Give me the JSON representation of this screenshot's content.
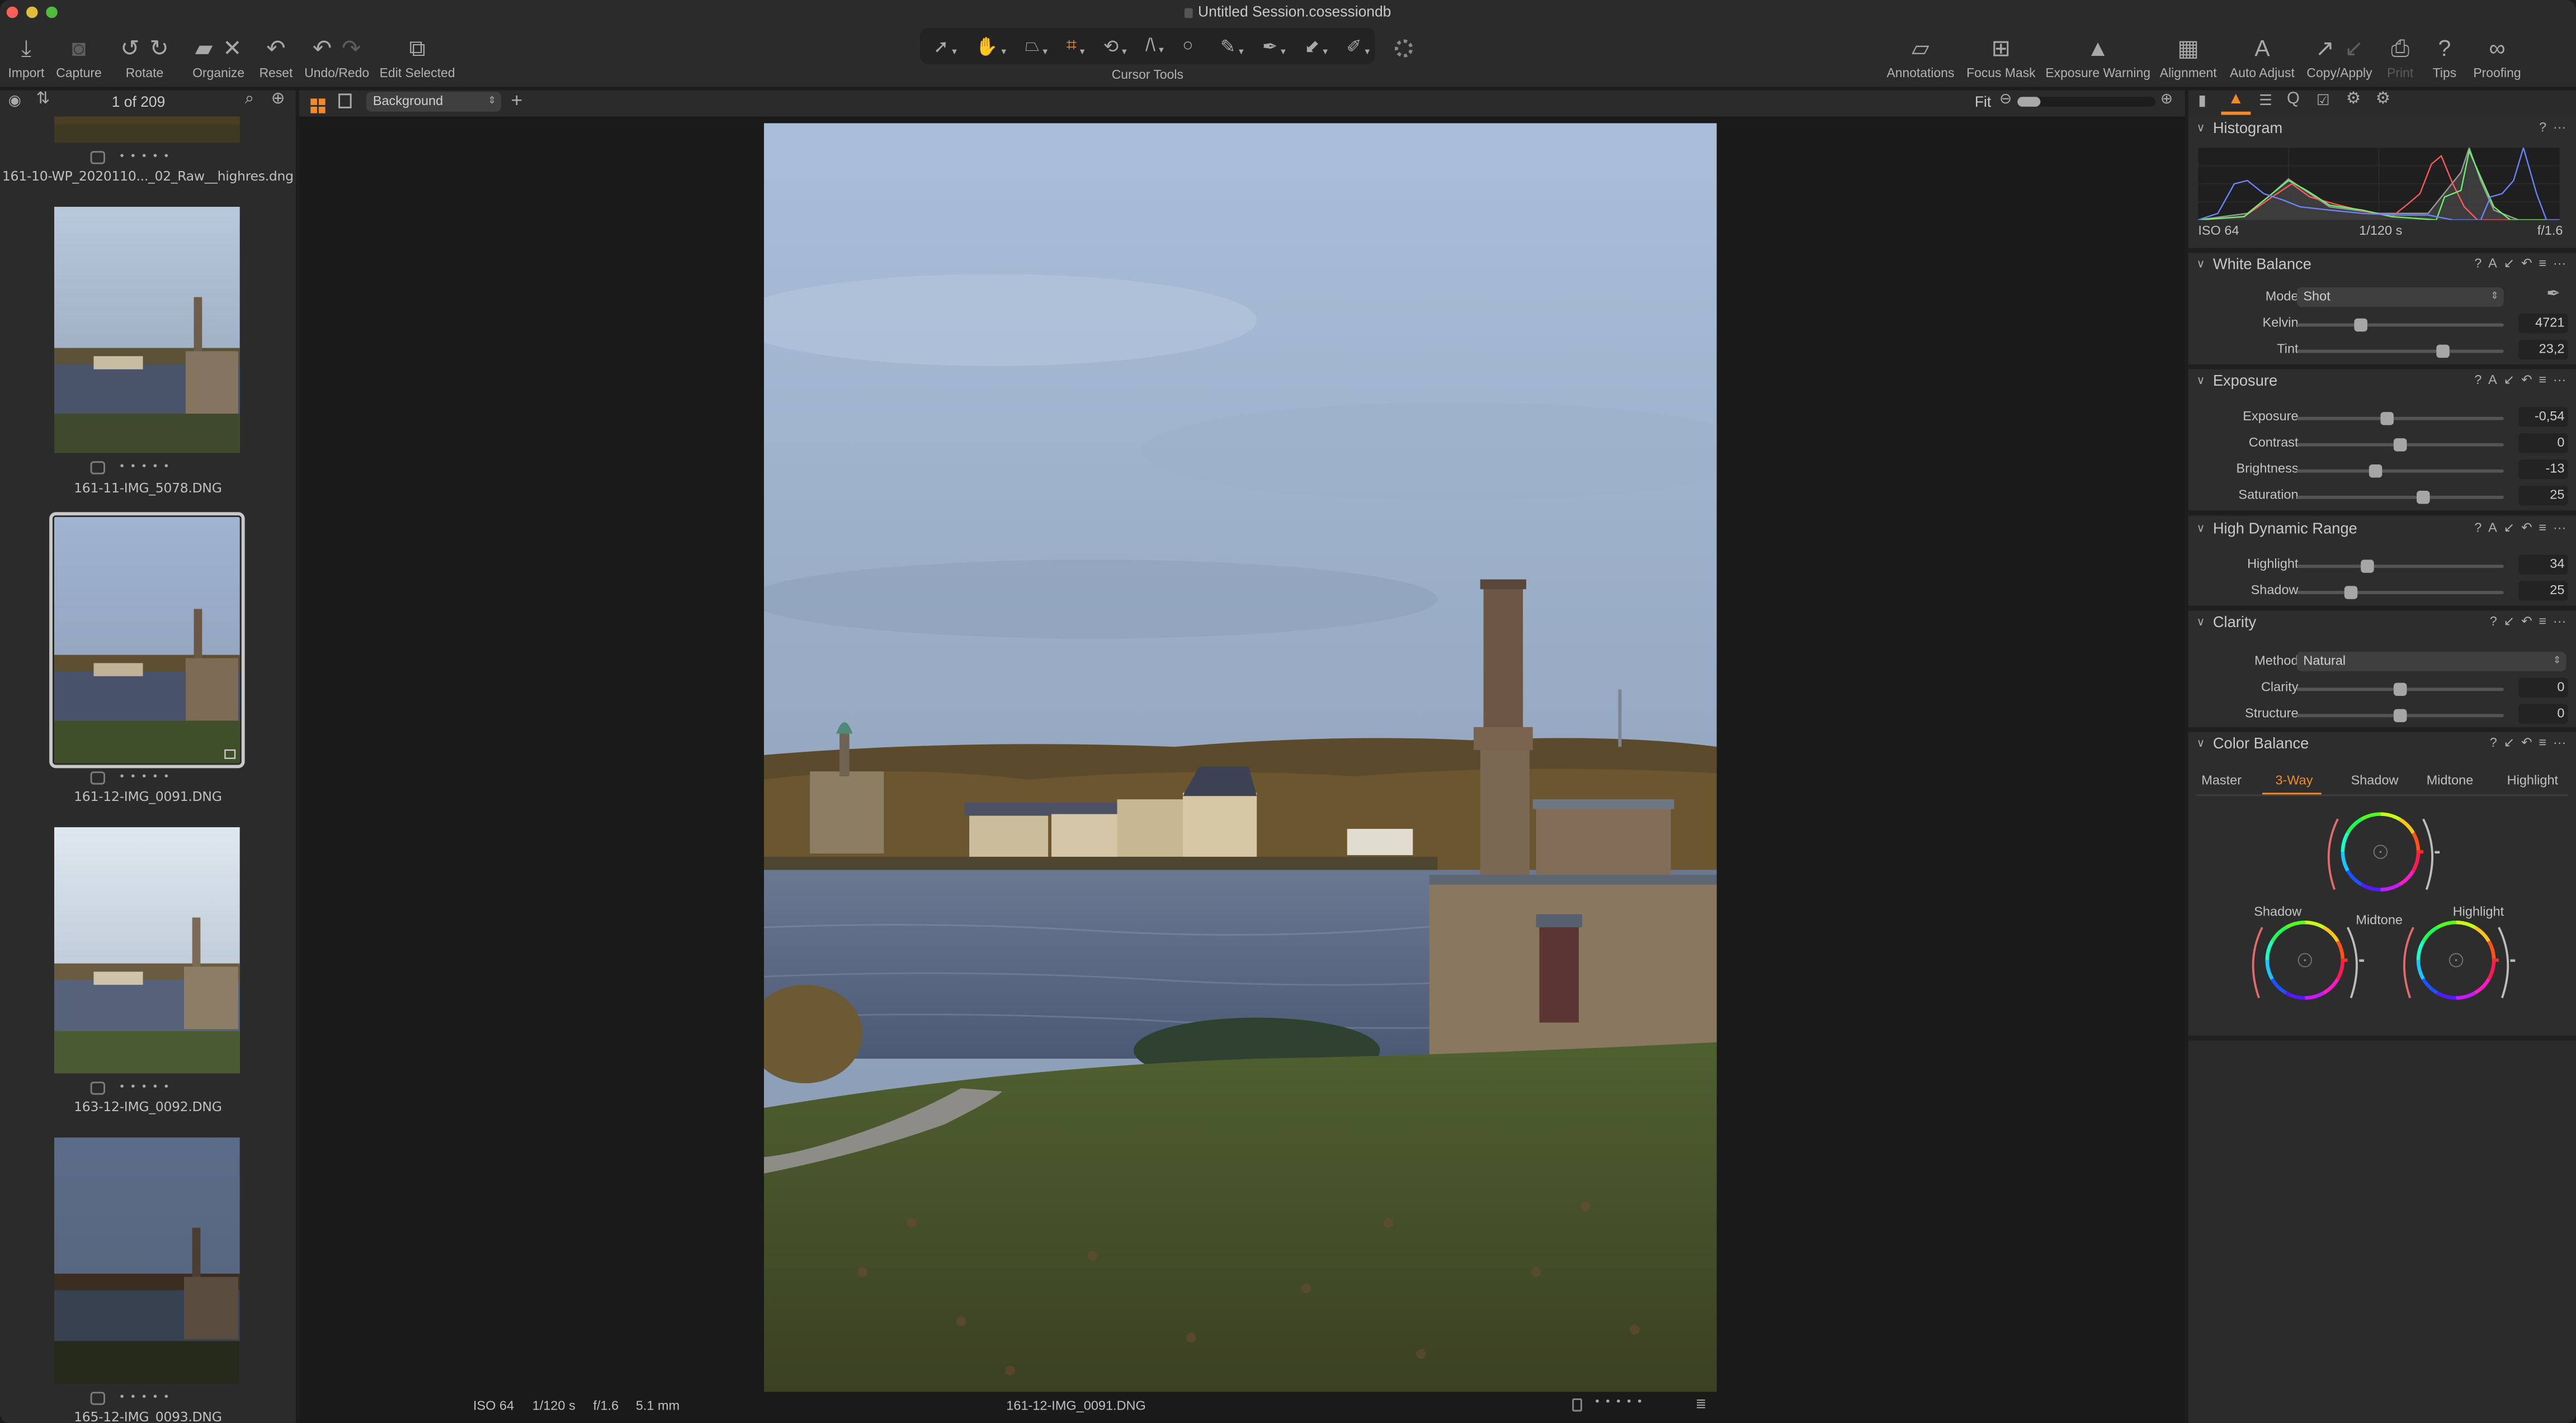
{
  "window": {
    "title": "Untitled Session.cosessiondb",
    "traffic_lights": [
      {
        "name": "close",
        "color": "#fe5f57"
      },
      {
        "name": "minimize",
        "color": "#e2bd39"
      },
      {
        "name": "zoom",
        "color": "#4fbd3b"
      }
    ]
  },
  "toolbar": {
    "left_groups": [
      {
        "label": "Import",
        "icons": [
          "import-icon"
        ]
      },
      {
        "label": "Capture",
        "icons": [
          "camera-icon"
        ]
      },
      {
        "label": "Rotate",
        "icons": [
          "rotate-left-icon",
          "rotate-right-icon"
        ]
      },
      {
        "label": "Organize",
        "icons": [
          "move-to-folder-icon",
          "delete-icon"
        ]
      },
      {
        "label": "Reset",
        "icons": [
          "reset-icon"
        ]
      },
      {
        "label": "Undo/Redo",
        "icons": [
          "undo-icon",
          "redo-icon"
        ]
      },
      {
        "label": "Edit Selected",
        "icons": [
          "edit-selected-icon"
        ]
      }
    ],
    "cursor_tools": {
      "label": "Cursor Tools",
      "tools": [
        "select-icon",
        "pan-icon",
        "keystone-icon",
        "crop-icon",
        "rotate-tool-icon",
        "straighten-icon",
        "spot-removal-icon",
        "brush-icon",
        "color-picker-icon",
        "eraser-icon",
        "annotate-pen-icon"
      ],
      "active": "crop-icon"
    },
    "right_groups": [
      {
        "label": "Annotations",
        "icons": [
          "annotations-icon"
        ],
        "disabled": false
      },
      {
        "label": "Focus Mask",
        "icons": [
          "focus-mask-icon"
        ],
        "disabled": false
      },
      {
        "label": "Exposure Warning",
        "icons": [
          "exposure-warning-icon"
        ],
        "disabled": false
      },
      {
        "label": "Alignment",
        "icons": [
          "grid-icon"
        ],
        "disabled": false
      },
      {
        "label": "Auto Adjust",
        "icons": [
          "auto-adjust-icon"
        ],
        "disabled": false
      },
      {
        "label": "Copy/Apply",
        "icons": [
          "copy-icon",
          "apply-icon"
        ],
        "disabled": false
      },
      {
        "label": "Print",
        "icons": [
          "printer-icon"
        ],
        "disabled": true
      },
      {
        "label": "Tips",
        "icons": [
          "help-icon"
        ],
        "disabled": false
      },
      {
        "label": "Proofing",
        "icons": [
          "proofing-glasses-icon"
        ],
        "disabled": false
      }
    ]
  },
  "browser": {
    "counter": "1 of 209",
    "items": [
      {
        "filename": "161-10-WP_2020110..._02_Raw__highres.dng",
        "selected": false,
        "rating": 0
      },
      {
        "filename": "161-11-IMG_5078.DNG",
        "selected": false,
        "rating": 0
      },
      {
        "filename": "161-12-IMG_0091.DNG",
        "selected": true,
        "rating": 0
      },
      {
        "filename": "163-12-IMG_0092.DNG",
        "selected": false,
        "rating": 0
      },
      {
        "filename": "165-12-IMG_0093.DNG",
        "selected": false,
        "rating": 0
      }
    ]
  },
  "viewer": {
    "layer_select": "Background",
    "zoom_label": "Fit",
    "zoom_slider_value": 0.05,
    "status": {
      "iso": "ISO 64",
      "shutter": "1/120 s",
      "aperture": "f/1.6",
      "focal_length": "5.1 mm",
      "filename": "161-12-IMG_0091.DNG"
    }
  },
  "tool_tabs": [
    "library-tab-icon",
    "exposure-tab-icon",
    "lens-tab-icon",
    "details-tab-icon",
    "metadata-tab-icon",
    "adjustments-tab-icon",
    "styles-tab-icon"
  ],
  "tool_tabs_active": "exposure-tab-icon",
  "tools": {
    "histogram": {
      "title": "Histogram",
      "iso": "ISO 64",
      "shutter": "1/120 s",
      "aperture": "f/1.6",
      "colors": {
        "red": "#ff5a5a",
        "green": "#6cf26c",
        "blue": "#6b84ff",
        "luma": "#9a9a9a"
      }
    },
    "white_balance": {
      "title": "White Balance",
      "mode_label": "Mode",
      "mode_value": "Shot",
      "sliders": [
        {
          "label": "Kelvin",
          "value": "4721",
          "position": 0.31
        },
        {
          "label": "Tint",
          "value": "23,2",
          "position": 0.71
        }
      ]
    },
    "exposure": {
      "title": "Exposure",
      "sliders": [
        {
          "label": "Exposure",
          "value": "-0,54",
          "position": 0.44
        },
        {
          "label": "Contrast",
          "value": "0",
          "position": 0.5
        },
        {
          "label": "Brightness",
          "value": "-13",
          "position": 0.38
        },
        {
          "label": "Saturation",
          "value": "25",
          "position": 0.61
        }
      ]
    },
    "hdr": {
      "title": "High Dynamic Range",
      "sliders": [
        {
          "label": "Highlight",
          "value": "34",
          "position": 0.34
        },
        {
          "label": "Shadow",
          "value": "25",
          "position": 0.26
        }
      ]
    },
    "clarity": {
      "title": "Clarity",
      "method_label": "Method",
      "method_value": "Natural",
      "sliders": [
        {
          "label": "Clarity",
          "value": "0",
          "position": 0.5
        },
        {
          "label": "Structure",
          "value": "0",
          "position": 0.5
        }
      ]
    },
    "color_balance": {
      "title": "Color Balance",
      "tabs": [
        "Master",
        "3-Way",
        "Shadow",
        "Midtone",
        "Highlight"
      ],
      "active_tab": "3-Way",
      "wheels": [
        {
          "label": "Midtone"
        },
        {
          "label": "Shadow"
        },
        {
          "label": "Highlight"
        }
      ]
    }
  },
  "accent_color": "#f28a29"
}
